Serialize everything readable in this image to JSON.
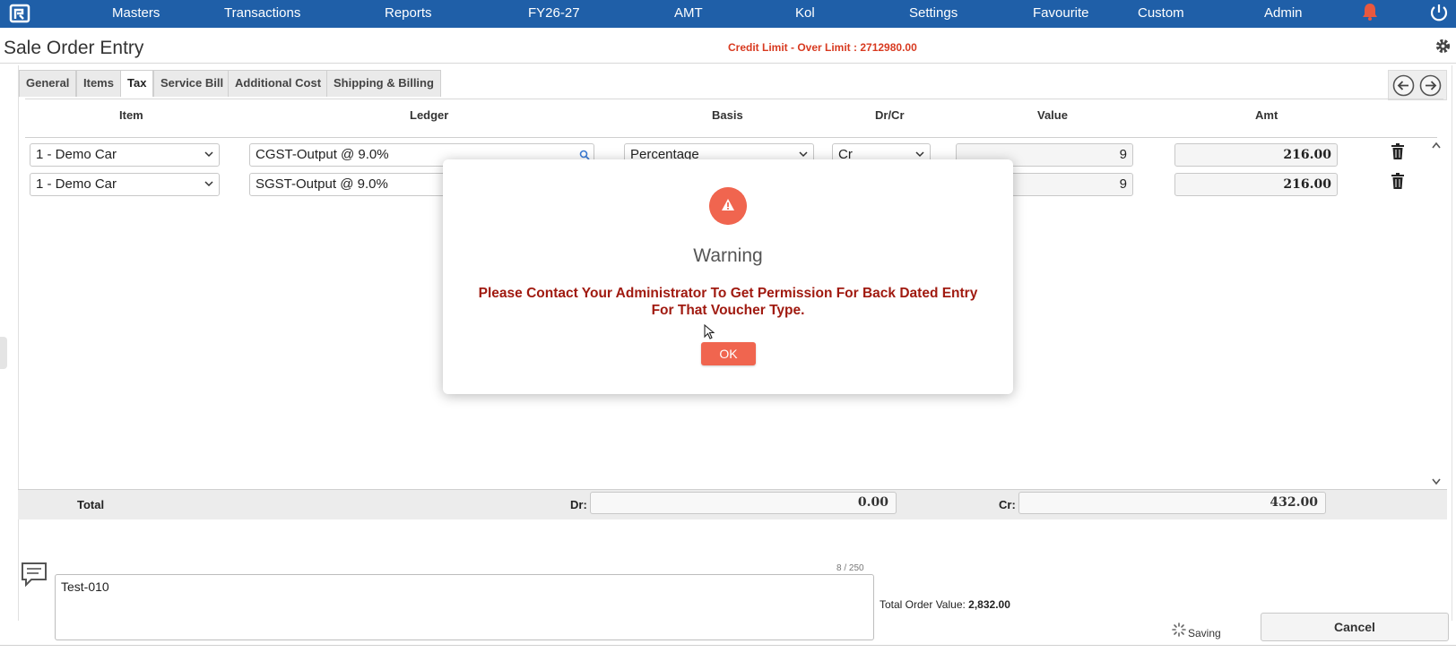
{
  "nav": {
    "items": [
      "Masters",
      "Transactions",
      "Reports",
      "FY26-27",
      "AMT",
      "Kol",
      "Settings",
      "Favourite",
      "Custom",
      "Admin"
    ]
  },
  "header": {
    "title": "Sale Order Entry",
    "credit_limit": "Credit Limit - Over Limit : 2712980.00"
  },
  "tabs": [
    "General",
    "Items",
    "Tax",
    "Service Bill",
    "Additional Cost",
    "Shipping & Billing"
  ],
  "active_tab": "Tax",
  "grid": {
    "columns": [
      "Item",
      "Ledger",
      "Basis",
      "Dr/Cr",
      "Value",
      "Amt"
    ],
    "rows": [
      {
        "item": "1 - Demo Car",
        "ledger": "CGST-Output @ 9.0%",
        "basis": "Percentage",
        "drcr": "Cr",
        "value": "9",
        "amt": "216.00"
      },
      {
        "item": "1 - Demo Car",
        "ledger": "SGST-Output @ 9.0%",
        "basis": "",
        "drcr": "",
        "value": "9",
        "amt": "216.00"
      }
    ]
  },
  "totals": {
    "label": "Total",
    "dr_label": "Dr:",
    "dr_value": "0.00",
    "cr_label": "Cr:",
    "cr_value": "432.00"
  },
  "footer": {
    "char_count": "8 / 250",
    "narration": "Test-010",
    "order_value_label": "Total Order Value:",
    "order_value": "2,832.00",
    "saving": "Saving",
    "cancel": "Cancel"
  },
  "modal": {
    "title": "Warning",
    "message_line1": "Please Contact Your Administrator To Get Permission For Back Dated Entry",
    "message_line2": "For That Voucher Type.",
    "ok": "OK"
  },
  "colors": {
    "nav_bg": "#1f5fa8",
    "warning_red": "#f0654f",
    "message_red": "#a01a10",
    "credit_red": "#d83a20"
  }
}
